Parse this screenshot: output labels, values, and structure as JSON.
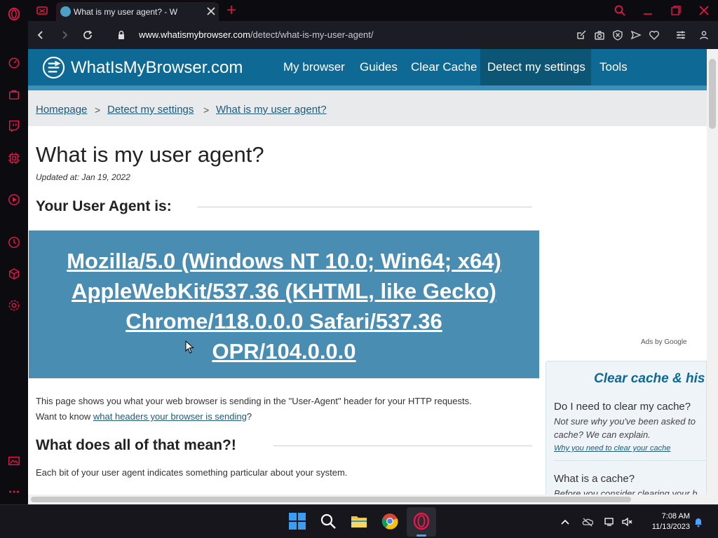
{
  "browser": {
    "tab_title": "What is my user agent? - W",
    "url_host": "www.whatismybrowser.com",
    "url_path": "/detect/what-is-my-user-agent/",
    "accent_color": "#e8174b"
  },
  "site": {
    "logo_text": "WhatIsMyBrowser.com",
    "nav": [
      "My browser",
      "Guides",
      "Clear Cache",
      "Detect my settings",
      "Tools"
    ],
    "breadcrumbs": [
      "Homepage",
      "Detect my settings",
      "What is my user agent?"
    ],
    "breadcrumb_separator": ">",
    "header_color": "#0e6a94"
  },
  "main": {
    "title": "What is my user agent?",
    "updated": "Updated at: Jan 19, 2022",
    "ua_heading": "Your User Agent is:",
    "ua_lines": [
      "Mozilla/5.0 (Windows NT 10.0; Win64; x64)",
      "AppleWebKit/537.36 (KHTML, like Gecko)",
      "Chrome/118.0.0.0 Safari/537.36",
      "OPR/104.0.0.0"
    ],
    "ua_box_color": "#4a8db3",
    "desc_1": "This page shows you what your web browser is sending in the \"User-Agent\" header for your HTTP requests.",
    "desc_2_prefix": "Want to know ",
    "desc_2_link": "what headers your browser is sending",
    "desc_2_suffix": "?",
    "meaning_heading": "What does all of that mean?!",
    "meaning_text": "Each bit of your user agent indicates something particular about your system."
  },
  "sidebar": {
    "ads_label": "Ads by Google",
    "card_title": "Clear cache & his",
    "q1": "Do I need to clear my cache?",
    "q1_sub_1": "Not sure why you've been asked to",
    "q1_sub_2": "cache? We can explain.",
    "q1_link": "Why you need to clear your cache",
    "q2": "What is a cache?",
    "q2_sub": "Before you consider clearing your b"
  },
  "taskbar": {
    "time": "7:08 AM",
    "date": "11/13/2023"
  }
}
